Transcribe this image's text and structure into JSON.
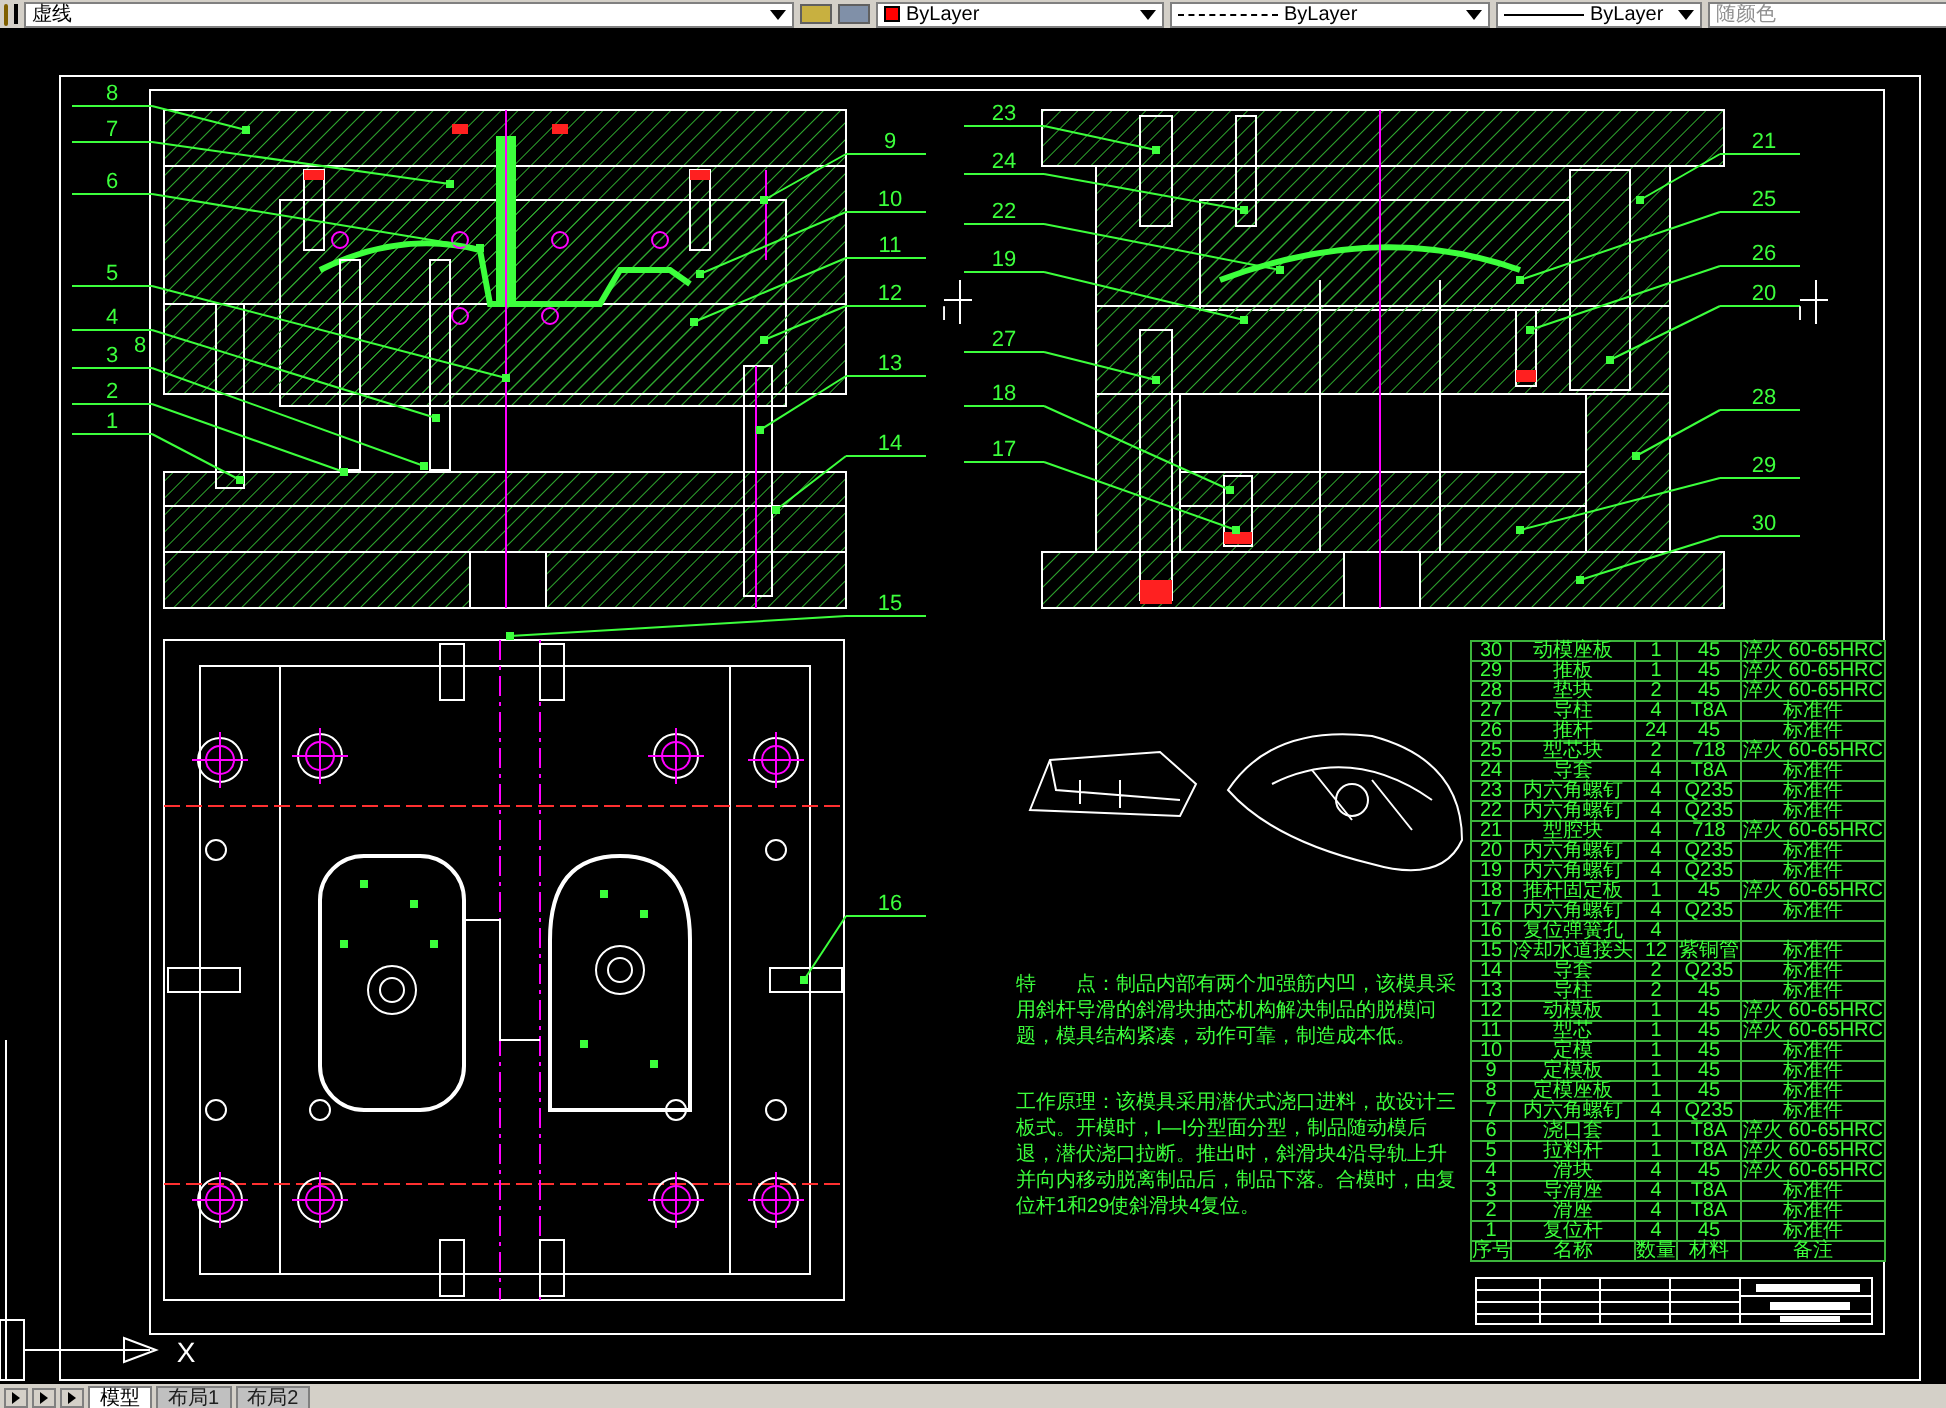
{
  "toolbar": {
    "dropdowns": [
      {
        "kind": "plain",
        "value": "虚线",
        "disabled": false
      },
      {
        "kind": "swatch",
        "value": "ByLayer",
        "disabled": false
      },
      {
        "kind": "dashed",
        "value": "ByLayer",
        "disabled": false
      },
      {
        "kind": "solid",
        "value": "ByLayer",
        "disabled": false
      },
      {
        "kind": "plain",
        "value": "随颜色",
        "disabled": true
      }
    ]
  },
  "left_section": {
    "labels": [
      "8",
      "7",
      "6",
      "5",
      "4",
      "3",
      "8",
      "2",
      "1",
      "9",
      "10",
      "11",
      "12",
      "13",
      "14",
      "15"
    ],
    "section_mark": "I"
  },
  "right_section": {
    "labels": [
      "23",
      "24",
      "22",
      "19",
      "27",
      "18",
      "17",
      "21",
      "25",
      "26",
      "20",
      "28",
      "29",
      "30"
    ],
    "section_mark": "I"
  },
  "plan_view": {
    "labels": [
      "16"
    ]
  },
  "notes": [
    "特　　点：制品内部有两个加强筋内凹，该模具采用斜杆导滑的斜滑块抽芯机构解决制品的脱模问题，模具结构紧凑，动作可靠，制造成本低。",
    "工作原理：该模具采用潜伏式浇口进料，故设计三板式。开模时，I—I分型面分型，制品随动模后退，潜伏浇口拉断。推出时，斜滑块4沿导轨上升并向内移动脱离制品后，制品下落。合模时，由复位杆1和29使斜滑块4复位。"
  ],
  "parts_list": {
    "rows": [
      {
        "no": "30",
        "name": "动模座板",
        "qty": "1",
        "material": "45",
        "note": "淬火 60-65HRC"
      },
      {
        "no": "29",
        "name": "推板",
        "qty": "1",
        "material": "45",
        "note": "淬火 60-65HRC"
      },
      {
        "no": "28",
        "name": "垫块",
        "qty": "2",
        "material": "45",
        "note": "淬火 60-65HRC"
      },
      {
        "no": "27",
        "name": "导柱",
        "qty": "4",
        "material": "T8A",
        "note": "标准件"
      },
      {
        "no": "26",
        "name": "推杆",
        "qty": "24",
        "material": "45",
        "note": "标准件"
      },
      {
        "no": "25",
        "name": "型芯块",
        "qty": "2",
        "material": "718",
        "note": "淬火 60-65HRC"
      },
      {
        "no": "24",
        "name": "导套",
        "qty": "4",
        "material": "T8A",
        "note": "标准件"
      },
      {
        "no": "23",
        "name": "内六角螺钉",
        "qty": "4",
        "material": "Q235",
        "note": "标准件"
      },
      {
        "no": "22",
        "name": "内六角螺钉",
        "qty": "4",
        "material": "Q235",
        "note": "标准件"
      },
      {
        "no": "21",
        "name": "型腔块",
        "qty": "4",
        "material": "718",
        "note": "淬火 60-65HRC"
      },
      {
        "no": "20",
        "name": "内六角螺钉",
        "qty": "4",
        "material": "Q235",
        "note": "标准件"
      },
      {
        "no": "19",
        "name": "内六角螺钉",
        "qty": "4",
        "material": "Q235",
        "note": "标准件"
      },
      {
        "no": "18",
        "name": "推杆固定板",
        "qty": "1",
        "material": "45",
        "note": "淬火 60-65HRC"
      },
      {
        "no": "17",
        "name": "内六角螺钉",
        "qty": "4",
        "material": "Q235",
        "note": "标准件"
      },
      {
        "no": "16",
        "name": "复位弹簧孔",
        "qty": "4"
      },
      {
        "no": "15",
        "name": "冷却水道接头",
        "qty": "12",
        "material": "紫铜管",
        "note": "标准件"
      },
      {
        "no": "14",
        "name": "导套",
        "qty": "2",
        "material": "Q235",
        "note": "标准件"
      },
      {
        "no": "13",
        "name": "导柱",
        "qty": "2",
        "material": "45",
        "note": "标准件"
      },
      {
        "no": "12",
        "name": "动模板",
        "qty": "1",
        "material": "45",
        "note": "淬火 60-65HRC"
      },
      {
        "no": "11",
        "name": "型芯",
        "qty": "1",
        "material": "45",
        "note": "淬火 60-65HRC"
      },
      {
        "no": "10",
        "name": "定模",
        "qty": "1",
        "material": "45",
        "note": "标准件"
      },
      {
        "no": "9",
        "name": "定模板",
        "qty": "1",
        "material": "45",
        "note": "标准件"
      },
      {
        "no": "8",
        "name": "定模座板",
        "qty": "1",
        "material": "45",
        "note": "标准件"
      },
      {
        "no": "7",
        "name": "内六角螺钉",
        "qty": "4",
        "material": "Q235",
        "note": "标准件"
      },
      {
        "no": "6",
        "name": "浇口套",
        "qty": "1",
        "material": "T8A",
        "note": "淬火 60-65HRC"
      },
      {
        "no": "5",
        "name": "拉料杆",
        "qty": "1",
        "material": "T8A",
        "note": "淬火 60-65HRC"
      },
      {
        "no": "4",
        "name": "滑块",
        "qty": "4",
        "material": "45",
        "note": "淬火 60-65HRC"
      },
      {
        "no": "3",
        "name": "导滑座",
        "qty": "4",
        "material": "T8A",
        "note": "标准件"
      },
      {
        "no": "2",
        "name": "滑座",
        "qty": "4",
        "material": "T8A",
        "note": "标准件"
      },
      {
        "no": "1",
        "name": "复位杆",
        "qty": "4",
        "material": "45",
        "note": "标准件"
      }
    ],
    "header": [
      "序号",
      "名称",
      "数量",
      "材料",
      "备注"
    ]
  },
  "ucs_axis_label": "X",
  "tabs": [
    {
      "label": "模型",
      "selected": true
    },
    {
      "label": "布局1",
      "selected": false
    },
    {
      "label": "布局2",
      "selected": false
    }
  ]
}
